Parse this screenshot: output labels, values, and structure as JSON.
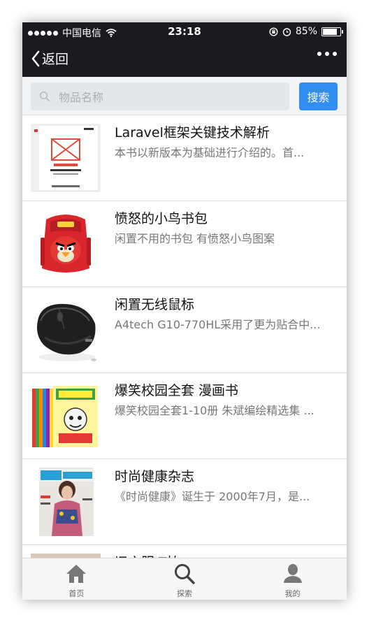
{
  "status_bar": {
    "carrier": "中国电信",
    "time": "23:18",
    "battery_percent": "85%",
    "battery_level": 0.85
  },
  "nav": {
    "back_label": "返回"
  },
  "search": {
    "placeholder": "物品名称",
    "button_label": "搜索",
    "accent_color": "#2f8ef0"
  },
  "items": [
    {
      "title": "Laravel框架关键技术解析",
      "desc": "本书以新版本为基础进行介绍的。首...",
      "thumb": "laravel-book-cover"
    },
    {
      "title": "愤怒的小鸟书包",
      "desc": "闲置不用的书包 有愤怒小鸟图案",
      "thumb": "angry-birds-backpack"
    },
    {
      "title": "闲置无线鼠标",
      "desc": "A4tech G10-770HL采用了更为贴合中...",
      "thumb": "wireless-mouse"
    },
    {
      "title": "爆笑校园全套 漫画书",
      "desc": "爆笑校园全套1-10册 朱斌编绘精选集 ...",
      "thumb": "comic-books"
    },
    {
      "title": "时尚健康杂志",
      "desc": "《时尚健康》诞生于 2000年7月，是...",
      "thumb": "magazine-cover"
    },
    {
      "title": "旧衣服 T恤",
      "desc": "",
      "thumb": "clothes"
    }
  ],
  "tabs": [
    {
      "label": "首页",
      "icon": "home-icon"
    },
    {
      "label": "探索",
      "icon": "search-icon"
    },
    {
      "label": "我的",
      "icon": "user-icon"
    }
  ]
}
